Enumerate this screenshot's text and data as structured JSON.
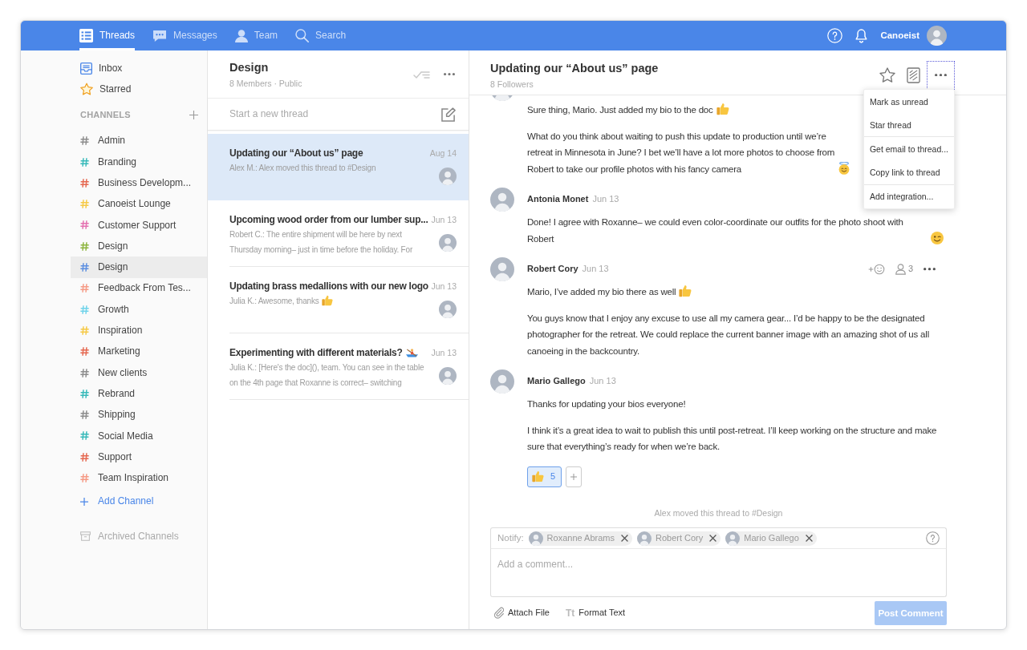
{
  "topbar": {
    "tabs": [
      {
        "label": "Threads",
        "selected": true
      },
      {
        "label": "Messages",
        "selected": false
      },
      {
        "label": "Team",
        "selected": false
      },
      {
        "label": "Search",
        "selected": false
      }
    ],
    "user": {
      "name": "Canoeist"
    }
  },
  "sidebar": {
    "items": [
      {
        "label": "Inbox",
        "kind": "inbox",
        "selected": false
      },
      {
        "label": "Starred",
        "kind": "starred",
        "selected": false
      }
    ],
    "channels_heading": "CHANNELS",
    "channels": [
      {
        "name": "Admin",
        "color": "#8c8c8c",
        "selected": false
      },
      {
        "name": "Branding",
        "color": "#36b9b9",
        "selected": false
      },
      {
        "name": "Business Developm...",
        "color": "#e5674f",
        "selected": false
      },
      {
        "name": "Canoeist Lounge",
        "color": "#f6c944",
        "selected": false
      },
      {
        "name": "Customer Support",
        "color": "#e46fb0",
        "selected": false
      },
      {
        "name": "Design",
        "color": "#8cb43c",
        "selected": false
      },
      {
        "name": "Design",
        "color": "#5b8ee0",
        "selected": true
      },
      {
        "name": "Feedback From Tes...",
        "color": "#f59a85",
        "selected": false
      },
      {
        "name": "Growth",
        "color": "#6fd3ea",
        "selected": false
      },
      {
        "name": "Inspiration",
        "color": "#f6c944",
        "selected": false
      },
      {
        "name": "Marketing",
        "color": "#e5674f",
        "selected": false
      },
      {
        "name": "New clients",
        "color": "#8c8c8c",
        "selected": false
      },
      {
        "name": "Rebrand",
        "color": "#36b9b9",
        "selected": false
      },
      {
        "name": "Shipping",
        "color": "#8c8c8c",
        "selected": false
      },
      {
        "name": "Social Media",
        "color": "#36b9b9",
        "selected": false
      },
      {
        "name": "Support",
        "color": "#e5674f",
        "selected": false
      },
      {
        "name": "Team Inspiration",
        "color": "#f59a85",
        "selected": false
      }
    ],
    "add_channel": "Add Channel",
    "archived": "Archived Channels"
  },
  "thread_list": {
    "title": "Design",
    "meta": "8 Members · Public",
    "new_thread_placeholder": "Start a new thread",
    "threads": [
      {
        "title": "Updating our “About us” page",
        "date": "Aug 14",
        "preview": "Alex M.: Alex moved this thread to #Design",
        "selected": true
      },
      {
        "title": "Upcoming wood order from our lumber sup...",
        "date": "Jun 13",
        "preview": "Robert C.: The entire shipment will be here by next Thursday morning– just in time before the holiday. For",
        "selected": false
      },
      {
        "title": "Updating brass medallions with our new logo",
        "date": "Jun 13",
        "preview": "Julia K.: Awesome, thanks",
        "preview_emoji": {
          "kind": "thumbs_up"
        },
        "selected": false
      },
      {
        "title": "Experimenting with different materials?",
        "title_emoji": {
          "kind": "rowboat"
        },
        "date": "Jun 13",
        "preview": "Julia K.: [Here's the doc](), team. You can see in the table on the 4th page that Roxanne is correct– switching",
        "selected": false
      }
    ]
  },
  "thread": {
    "title": "Updating our “About us” page",
    "followers": "8 Followers",
    "menu_open": true,
    "menu": [
      {
        "label": "Mark as unread",
        "divider_after": false
      },
      {
        "label": "Star thread",
        "divider_after": true
      },
      {
        "label": "Get email to thread...",
        "divider_after": false
      },
      {
        "label": "Copy link to thread",
        "divider_after": true
      },
      {
        "label": "Add integration...",
        "divider_after": false
      }
    ],
    "messages": [
      {
        "show_actions": false,
        "paragraphs": [
          {
            "text": "Sure thing, Mario. Just added my bio to the doc",
            "emoji": {
              "kind": "thumbs_up"
            }
          },
          {
            "lines": [
              "What do you think about waiting to push this update to production until we’re",
              "retreat in Minnesota in June? I bet we’ll have a lot more photos to choose from",
              "Robert to take our profile photos with his fancy camera"
            ],
            "emoji": {
              "kind": "halo"
            }
          }
        ]
      },
      {
        "author": "Antonia Monet",
        "date": "Jun 13",
        "show_actions": false,
        "paragraphs": [
          {
            "text": "Done! I agree with Roxanne– we could even color-coordinate our outfits for the photo shoot with Robert",
            "emoji": {
              "kind": "wink"
            }
          }
        ]
      },
      {
        "author": "Robert Cory",
        "date": "Jun 13",
        "show_actions": true,
        "participants": "3",
        "paragraphs": [
          {
            "text": "Mario, I’ve added my bio there as well",
            "emoji": {
              "kind": "thumbs_up"
            }
          },
          {
            "text": "You guys know that I enjoy any excuse to use all my camera gear... I’d be happy to be the designated photographer for the retreat. We could replace the current banner image with an amazing shot of us all canoeing in the backcountry."
          }
        ]
      },
      {
        "author": "Mario Gallego",
        "date": "Jun 13",
        "show_actions": false,
        "paragraphs": [
          {
            "text": "Thanks for updating your bios everyone!"
          },
          {
            "text": "I think it’s a great idea to wait to publish this until post-retreat. I’ll keep working on the structure and make sure that everything’s ready for when we’re back."
          }
        ],
        "reactions": [
          {
            "kind": "thumbs_up",
            "count": "5",
            "selected": true
          }
        ]
      }
    ],
    "system_note": "Alex moved this thread to #Design",
    "composer": {
      "notify_label": "Notify:",
      "recipients": [
        {
          "name": "Roxanne Abrams"
        },
        {
          "name": "Robert Cory"
        },
        {
          "name": "Mario Gallego"
        }
      ],
      "placeholder": "Add a comment...",
      "attach": "Attach File",
      "format": {
        "glyph": "Tt",
        "label": "Format Text"
      },
      "post": {
        "label": "Post Comment",
        "disabled": true
      }
    }
  }
}
